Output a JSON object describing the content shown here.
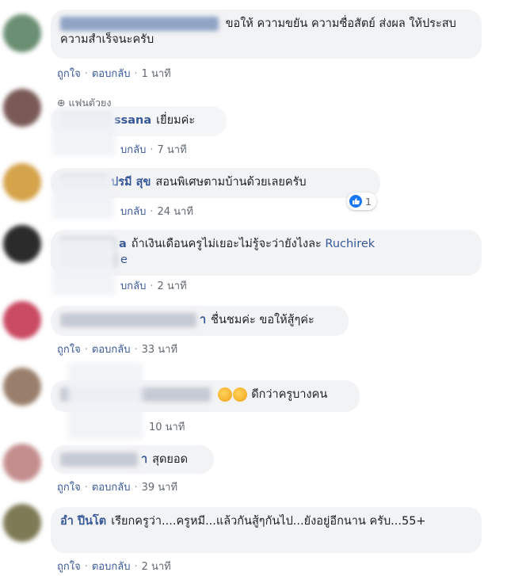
{
  "comments": [
    {
      "text": "ขอให้ ความขยัน ความซื่อสัตย์ ส่งผล ให้ประสบความสำเร็จนะครับ",
      "actions": {
        "like": "ถูกใจ",
        "reply": "ตอบกลับ",
        "time": "1 นาที"
      },
      "avatar_color": "#6b8f73"
    },
    {
      "badge": "แฟนตัวยง",
      "author_partial": "ssana",
      "text": "เยี่ยมค่ะ",
      "actions": {
        "reply_partial": "บกลับ",
        "time": "7 นาที"
      },
      "avatar_color": "#7a5a57"
    },
    {
      "author_partial": "ปรมี สุข",
      "text": "สอนพิเศษตามบ้านด้วยเลยครับ",
      "reaction_count": "1",
      "actions": {
        "reply_partial": "บกลับ",
        "time": "24 นาที"
      },
      "avatar_color": "#d4a34a"
    },
    {
      "author_partial": "a",
      "text": "ถ้าเงินเดือนครูไม่เยอะไม่รู้จะว่ายังไงละ",
      "mention": "Ruchirek",
      "mention_tail": "e",
      "actions": {
        "reply_partial": "บกลับ",
        "time": "2 นาที"
      },
      "avatar_color": "#2b2b2b"
    },
    {
      "author_partial": "า",
      "text": "ชื่นชมค่ะ ขอให้สู้ๆค่ะ",
      "actions": {
        "like": "ถูกใจ",
        "reply": "ตอบกลับ",
        "time": "33 นาที"
      },
      "avatar_color": "#c94a63"
    },
    {
      "text": "ดีกว่าครูบางคน",
      "actions": {
        "time": "10 นาที"
      },
      "avatar_color": "#9a7e6c"
    },
    {
      "author_partial": "า",
      "text": "สุดยอด",
      "actions": {
        "like": "ถูกใจ",
        "reply": "ตอบกลับ",
        "time": "39 นาที"
      },
      "avatar_color": "#c48e8e"
    },
    {
      "author": "อำ ปีนโต",
      "text": "เรียกครูว่า....ครูหมี...แล้วกันสู้ๆกันไป...ยังอยู่อีกนาน ครับ...55+",
      "actions": {
        "like": "ถูกใจ",
        "reply": "ตอบกลับ",
        "time": "2 นาที"
      },
      "avatar_color": "#7d7a56"
    }
  ],
  "colors": {
    "bubble": "#f2f3f5",
    "link": "#385898",
    "meta": "#606770",
    "like_blue": "#1877f2"
  }
}
